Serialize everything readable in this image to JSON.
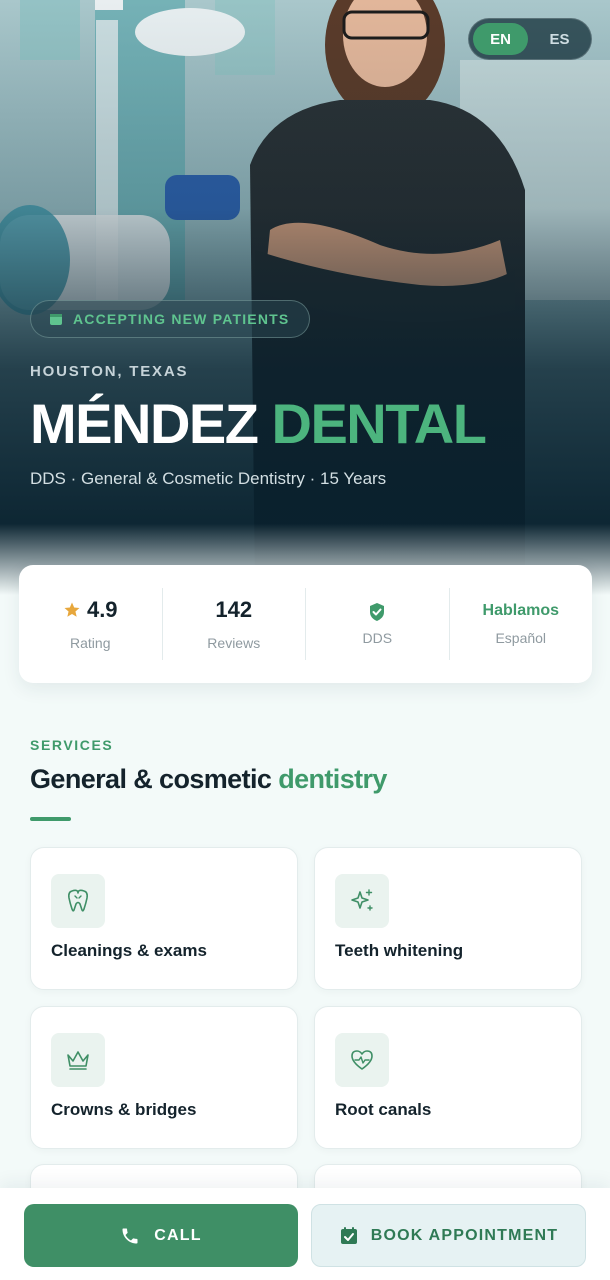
{
  "colors": {
    "accent": "#3f9a6b",
    "accent_bright": "#4cb47e",
    "hero_dark": "#0c2a36",
    "page_bg": "#f3faf9",
    "star": "#e7a73c"
  },
  "language_toggle": {
    "options": [
      "EN",
      "ES"
    ],
    "selected": "EN"
  },
  "hero": {
    "badge": {
      "icon": "calendar-icon",
      "label": "ACCEPTING NEW PATIENTS"
    },
    "location": "HOUSTON, TEXAS",
    "title_part1": "MÉNDEZ",
    "title_part2": "DENTAL",
    "subtitle": "DDS · General & Cosmetic Dentistry · 15 Years"
  },
  "stats": [
    {
      "icon": "star-icon",
      "value": "4.9",
      "label": "Rating"
    },
    {
      "value": "142",
      "label": "Reviews"
    },
    {
      "icon": "shield-check-icon",
      "label": "DDS"
    },
    {
      "value": "Hablamos",
      "label": "Español"
    }
  ],
  "services": {
    "kicker": "SERVICES",
    "title_part1": "General & cosmetic",
    "title_part2": "dentistry",
    "items": [
      {
        "icon": "tooth-icon",
        "label": "Cleanings & exams"
      },
      {
        "icon": "sparkle-icon",
        "label": "Teeth whitening"
      },
      {
        "icon": "crown-icon",
        "label": "Crowns & bridges"
      },
      {
        "icon": "heart-pulse-icon",
        "label": "Root canals"
      }
    ]
  },
  "bottom_bar": {
    "call": {
      "icon": "phone-icon",
      "label": "CALL"
    },
    "book": {
      "icon": "calendar-check-icon",
      "label": "BOOK APPOINTMENT"
    }
  }
}
